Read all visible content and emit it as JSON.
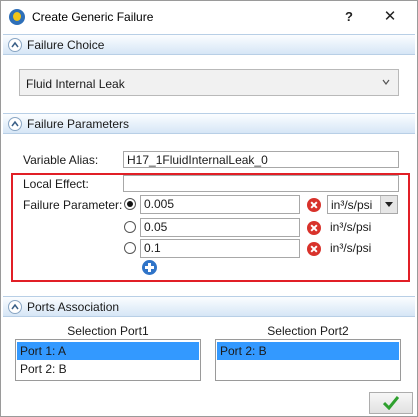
{
  "window": {
    "title": "Create Generic Failure"
  },
  "titlebar": {
    "help_label": "?",
    "close_label": "✕"
  },
  "failure_choice": {
    "section_title": "Failure Choice",
    "selected_value": "Fluid Internal Leak"
  },
  "failure_parameters": {
    "section_title": "Failure Parameters",
    "variable_alias_label": "Variable Alias:",
    "variable_alias_value": "H17_1FluidInternalLeak_0",
    "local_effect_label": "Local Effect:",
    "local_effect_value": "",
    "failure_parameter_label": "Failure Parameter:",
    "values": [
      {
        "value": "0.005",
        "unit": "in³/s/psi",
        "selected": true
      },
      {
        "value": "0.05",
        "unit": "in³/s/psi",
        "selected": false
      },
      {
        "value": "0.1",
        "unit": "in³/s/psi",
        "selected": false
      }
    ]
  },
  "ports_association": {
    "section_title": "Ports Association",
    "port1_header": "Selection Port1",
    "port2_header": "Selection Port2",
    "port1_items": [
      {
        "label": "Port 1: A",
        "selected": true
      },
      {
        "label": "Port 2: B",
        "selected": false
      }
    ],
    "port2_items": [
      {
        "label": "Port 2: B",
        "selected": true
      }
    ]
  },
  "colors": {
    "highlight_frame": "#e11f26",
    "selection": "#3399ff",
    "ok_check": "#2ea02e",
    "delete": "#d8322b",
    "add": "#2f74c8"
  }
}
